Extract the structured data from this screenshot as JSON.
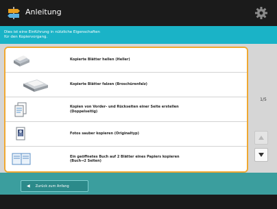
{
  "window": {
    "title": "Anleitung",
    "icons": {
      "app": "signpost-icon",
      "settings": "gear-icon"
    }
  },
  "description": {
    "line1": "Dies ist eine Einführung in nützliche Eigenschaften",
    "line2": "für den Kopiervorgang."
  },
  "list": {
    "items": [
      {
        "icon": "copy-sheets-light-icon",
        "line1": "Kopierte Blätter hellen (Heller)",
        "line2": ""
      },
      {
        "icon": "copy-sheets-tray-icon",
        "line1": "Kopierte Blätter falzen (Broschürenfalz)",
        "line2": ""
      },
      {
        "icon": "duplex-copy-icon",
        "line1": "Kopien von Vorder- und Rückseiten einer Seite erstellen",
        "line2": "(Doppelseitig)"
      },
      {
        "icon": "photo-copy-icon",
        "line1": "Fotos sauber kopieren (Originaltyp)",
        "line2": ""
      },
      {
        "icon": "book-copy-icon",
        "line1": "Ein geöffnetes Buch auf 2 Blätter eines Papiers kopieren",
        "line2": "(Buch→2 Seiten)"
      }
    ]
  },
  "pager": {
    "label": "1/5",
    "up_icon": "scroll-up-icon",
    "down_icon": "scroll-down-icon"
  },
  "footer": {
    "back_label": "Zurück zum Anfang",
    "back_icon": "back-arrow-icon"
  },
  "colors": {
    "accent": "#1ab3c7",
    "frame": "#f0a830",
    "bottom": "#3b9e9e"
  }
}
